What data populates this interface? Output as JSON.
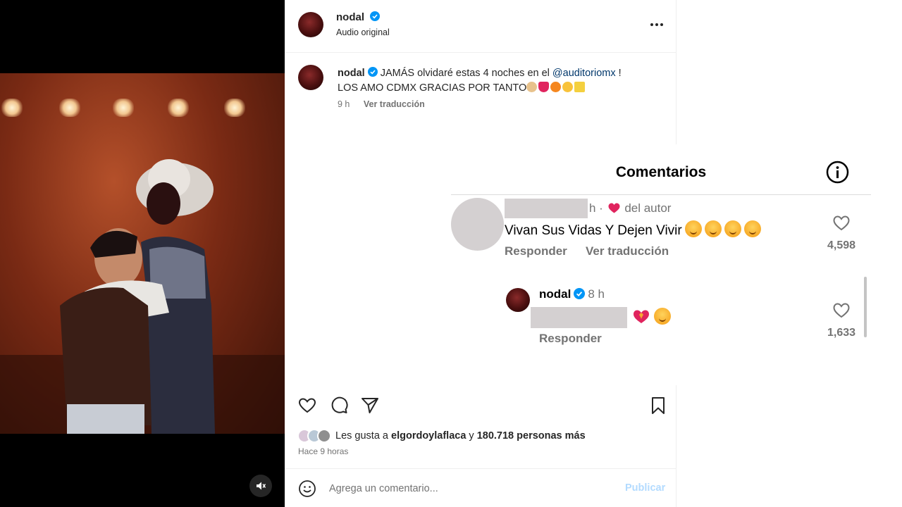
{
  "post": {
    "username": "nodal",
    "audio": "Audio original",
    "caption": {
      "username": "nodal",
      "line1_pre": "JAMÁS olvidaré estas 4 noches en el",
      "mention": "@auditoriomx",
      "line1_post": "!",
      "line2": "LOS AMO CDMX GRACIAS POR TANTO",
      "time": "9 h",
      "translate": "Ver traducción"
    },
    "likes": {
      "prefix": "Les gusta a",
      "user": "elgordoylaflaca",
      "middle": "y",
      "count": "180.718 personas más"
    },
    "time_ago": "Hace 9 horas",
    "comment_box": {
      "placeholder": "Agrega un comentario...",
      "publish": "Publicar"
    }
  },
  "comments": {
    "title": "Comentarios",
    "items": [
      {
        "time": "h ·",
        "liked_by_author": "del autor",
        "text": "Vivan Sus Vidas Y Dejen Vivir",
        "reply": "Responder",
        "translate": "Ver traducción",
        "likes": "4,598"
      },
      {
        "username": "nodal",
        "time": "8 h",
        "reply": "Responder",
        "likes": "1,633"
      }
    ]
  },
  "icons": [
    "verified-badge-icon",
    "more-options-icon",
    "heart-icon",
    "comment-icon",
    "share-icon",
    "bookmark-icon",
    "emoji-icon",
    "info-icon",
    "mute-icon"
  ],
  "colors": {
    "link": "#00376b",
    "verified": "#0095f6",
    "heart_red": "#e0245e",
    "publish_disabled": "#b3dbff"
  }
}
